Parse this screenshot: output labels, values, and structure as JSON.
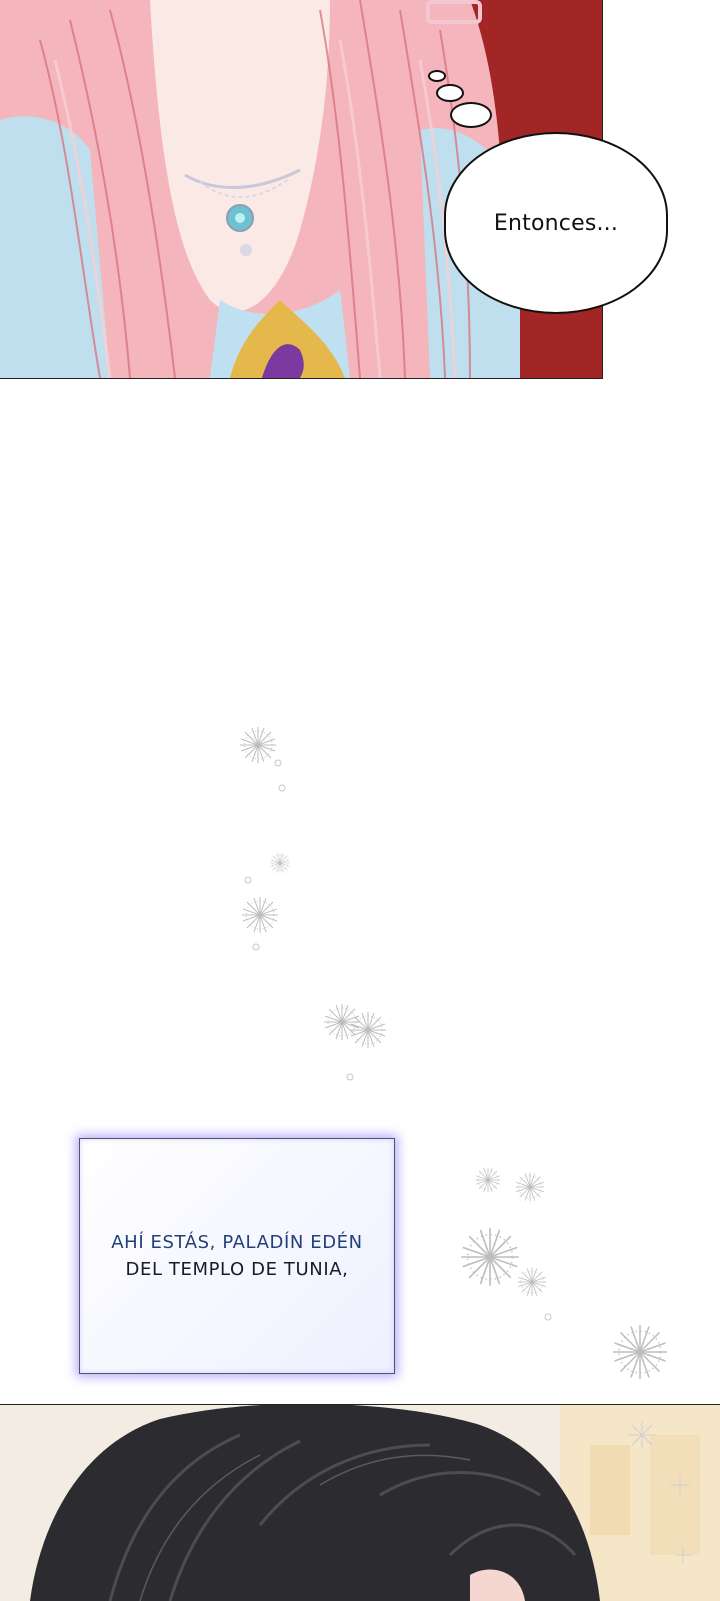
{
  "speech_bubble": {
    "text": "Entonces..."
  },
  "narration": {
    "line1": "AHÍ ESTÁS, PALADÍN EDÉN",
    "line2": "DEL TEMPLO DE TUNIA,"
  },
  "colors": {
    "background_red": "#9b2323",
    "hair_pink": "#f2a0a8",
    "dress_blue": "#bfe0ee",
    "narration_text_blue": "#22407a",
    "narration_glow": "#7a6eff",
    "dark_hair": "#2a2a2e"
  }
}
